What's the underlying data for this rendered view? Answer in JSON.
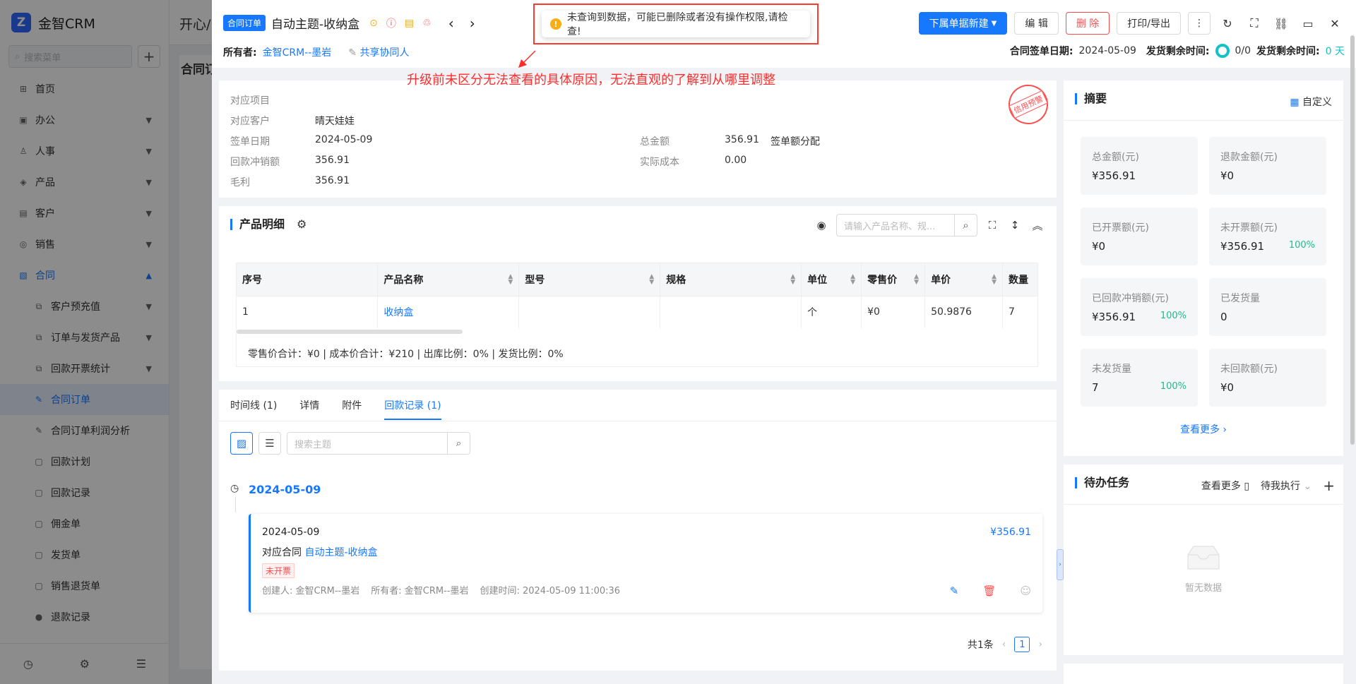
{
  "app": {
    "name": "金智CRM",
    "search_placeholder": "搜索菜单",
    "topbar_text": "开心/",
    "content_title": "合同订",
    "nav": [
      {
        "label": "首页",
        "icon": "home-icon"
      },
      {
        "label": "办公",
        "icon": "office-icon"
      },
      {
        "label": "人事",
        "icon": "people-icon"
      },
      {
        "label": "产品",
        "icon": "product-icon"
      },
      {
        "label": "客户",
        "icon": "customer-icon"
      },
      {
        "label": "销售",
        "icon": "sales-icon"
      },
      {
        "label": "合同",
        "icon": "contract-icon"
      }
    ],
    "sub_nav": [
      {
        "label": "客户预充值"
      },
      {
        "label": "订单与发货产品"
      },
      {
        "label": "回款开票统计"
      },
      {
        "label": "合同订单"
      },
      {
        "label": "合同订单利润分析"
      },
      {
        "label": "回款计划"
      },
      {
        "label": "回款记录"
      },
      {
        "label": "佣金单"
      },
      {
        "label": "发货单"
      },
      {
        "label": "销售退货单"
      },
      {
        "label": "退款记录"
      }
    ]
  },
  "header": {
    "doc_type": "合同订单",
    "title": "自动主题-收纳盒",
    "owner_label": "所有者:",
    "owner_value": "金智CRM--墨岩",
    "share_label": "共享协同人",
    "new_sub_label": "下属单据新建",
    "edit_label": "编 辑",
    "delete_label": "删 除",
    "print_label": "打印/导出",
    "sign_date_label": "合同签单日期:",
    "sign_date_value": "2024-05-09",
    "ship_left_label": "发货剩余时间:",
    "ship_count": "0/0",
    "ship_left_label2": "发货剩余时间:",
    "ship_days": "0 天"
  },
  "toast": {
    "message": "未查询到数据，可能已删除或者没有操作权限,请检查!"
  },
  "annotation": {
    "text": "升级前未区分无法查看的具体原因，无法直观的了解到从哪里调整"
  },
  "info": {
    "project_label": "对应项目",
    "customer_label": "对应客户",
    "customer_value": "晴天娃娃",
    "sign_date_label": "签单日期",
    "sign_date_value": "2024-05-09",
    "total_label": "总金额",
    "total_value": "356.91",
    "total_extra": "签单额分配",
    "writeoff_label": "回款冲销额",
    "writeoff_value": "356.91",
    "cost_label": "实际成本",
    "cost_value": "0.00",
    "profit_label": "毛利",
    "profit_value": "356.91",
    "stamp_text": "信用预警"
  },
  "product": {
    "title": "产品明细",
    "search_placeholder": "请输入产品名称、规...",
    "columns": [
      "序号",
      "产品名称",
      "型号",
      "规格",
      "单位",
      "零售价",
      "单价",
      "数量"
    ],
    "rows": [
      [
        "1",
        "收纳盒",
        "",
        "",
        "个",
        "¥0",
        "50.9876",
        "7"
      ]
    ],
    "summary": "零售价合计：¥0 |    成本价合计：¥210 |    出库比例：0% |    发货比例：0%"
  },
  "records": {
    "tabs": [
      {
        "label": "时间线 (1)"
      },
      {
        "label": "详情"
      },
      {
        "label": "附件"
      },
      {
        "label": "回款记录 (1)"
      }
    ],
    "search_placeholder": "搜索主题",
    "group_date": "2024-05-09",
    "item": {
      "date": "2024-05-09",
      "amount": "¥356.91",
      "contract_label": "对应合同",
      "contract_link": "自动主题-收纳盒",
      "status": "未开票",
      "creator": "创建人: 金智CRM--墨岩",
      "owner": "所有者: 金智CRM--墨岩",
      "created_at": "创建时间: 2024-05-09 11:00:36"
    },
    "total": "共1条",
    "page": "1"
  },
  "summary": {
    "title": "摘要",
    "customize": "自定义",
    "stats": [
      {
        "label": "总金额(元)",
        "value": "¥356.91",
        "pct": ""
      },
      {
        "label": "退款金额(元)",
        "value": "¥0",
        "pct": ""
      },
      {
        "label": "已开票额(元)",
        "value": "¥0",
        "pct": ""
      },
      {
        "label": "未开票额(元)",
        "value": "¥356.91",
        "pct": "100%"
      },
      {
        "label": "已回款冲销额(元)",
        "value": "¥356.91",
        "pct": "100%"
      },
      {
        "label": "已发货量",
        "value": "0",
        "pct": ""
      },
      {
        "label": "未发货量",
        "value": "7",
        "pct": "100%"
      },
      {
        "label": "未回款额(元)",
        "value": "¥0",
        "pct": ""
      }
    ],
    "more": "查看更多"
  },
  "todo": {
    "title": "待办任务",
    "more": "查看更多",
    "filter": "待我执行",
    "empty": "暂无数据"
  }
}
